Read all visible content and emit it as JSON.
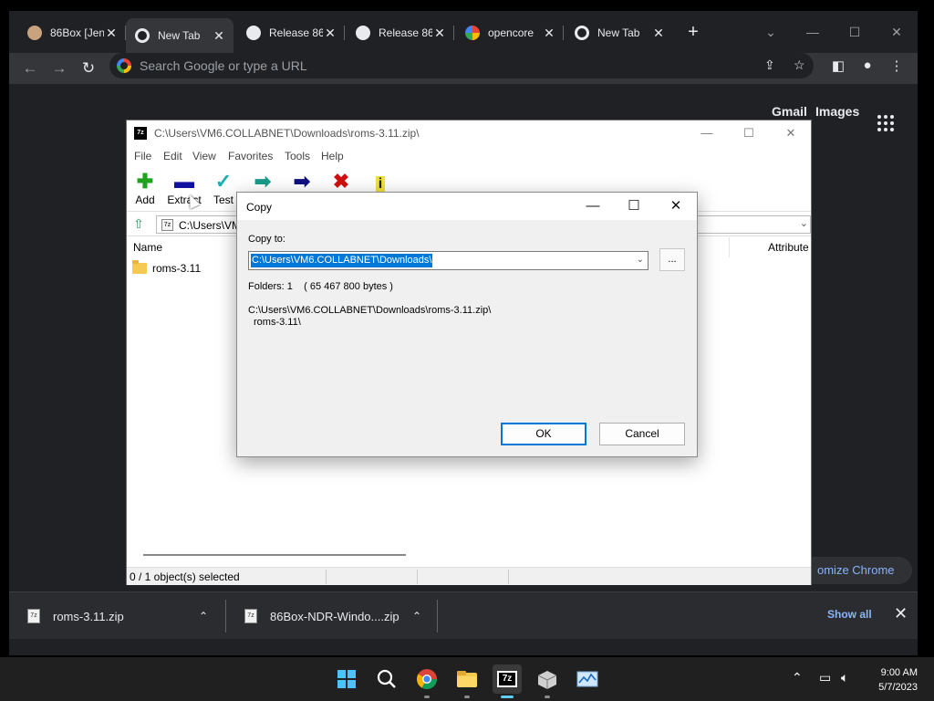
{
  "chrome": {
    "tabs": [
      {
        "label": "86Box [Jen",
        "icon": "avatar-icon",
        "active": false
      },
      {
        "label": "New Tab",
        "icon": "chrome-icon",
        "active": true
      },
      {
        "label": "Release 86",
        "icon": "github-icon",
        "active": false
      },
      {
        "label": "Release 86",
        "icon": "github-icon",
        "active": false
      },
      {
        "label": "opencore",
        "icon": "google-icon",
        "active": false
      },
      {
        "label": "New Tab",
        "icon": "chrome-icon",
        "active": false
      }
    ],
    "new_tab_symbol": "+",
    "omnibox_placeholder": "Search Google or type a URL",
    "ntp": {
      "gmail": "Gmail",
      "images": "Images",
      "customize": "omize Chrome"
    }
  },
  "download_shelf": {
    "items": [
      {
        "name": "roms-3.11.zip"
      },
      {
        "name": "86Box-NDR-Windo....zip"
      }
    ],
    "show_all": "Show all"
  },
  "sevenzip": {
    "title": "C:\\Users\\VM6.COLLABNET\\Downloads\\roms-3.11.zip\\",
    "menu": [
      "File",
      "Edit",
      "View",
      "Favorites",
      "Tools",
      "Help"
    ],
    "toolbar": {
      "add": "Add",
      "extract": "Extract",
      "test": "Test"
    },
    "address": "C:\\Users\\VM",
    "columns": {
      "name": "Name",
      "attributes": "Attribute"
    },
    "rows": [
      {
        "name": "roms-3.11"
      }
    ],
    "status": "0 / 1 object(s) selected"
  },
  "copy_dialog": {
    "title": "Copy",
    "copy_to_label": "Copy to:",
    "destination": "C:\\Users\\VM6.COLLABNET\\Downloads\\",
    "browse": "...",
    "info": "Folders: 1    ( 65 467 800 bytes )",
    "path_line1": "C:\\Users\\VM6.COLLABNET\\Downloads\\roms-3.11.zip\\",
    "path_line2": "roms-3.11\\",
    "ok": "OK",
    "cancel": "Cancel"
  },
  "taskbar": {
    "apps": [
      "windows-start",
      "search",
      "chrome",
      "file-explorer",
      "7-zip",
      "86box",
      "task-manager"
    ],
    "active_app": "7-zip",
    "zip_app_label": "7z",
    "time": "9:00 AM",
    "date": "5/7/2023"
  },
  "colors": {
    "chrome_bg": "#202124",
    "selection": "#0078d7",
    "link": "#8ab4f8",
    "taskbar_accent": "#60cdff"
  }
}
